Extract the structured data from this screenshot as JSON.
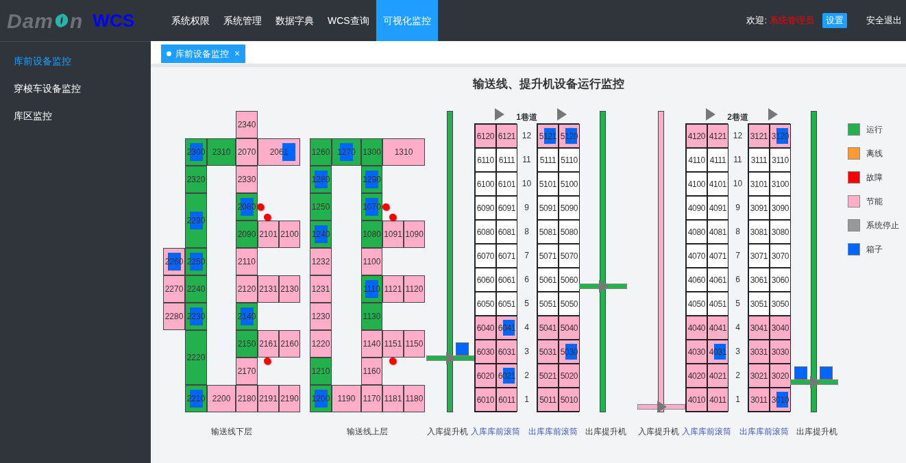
{
  "header": {
    "logo_before": "Dam",
    "logo_after": "n",
    "product": "WCS",
    "nav": [
      {
        "label": "系统权限",
        "selected": false
      },
      {
        "label": "系统管理",
        "selected": false
      },
      {
        "label": "数据字典",
        "selected": false
      },
      {
        "label": "WCS查询",
        "selected": false
      },
      {
        "label": "可视化监控",
        "selected": true
      }
    ],
    "welcome": "欢迎:",
    "user": "系统管理员",
    "settings": "设置",
    "logout": "安全退出"
  },
  "sidebar": {
    "items": [
      {
        "label": "库前设备监控",
        "selected": true
      },
      {
        "label": "穿梭车设备监控",
        "selected": false
      },
      {
        "label": "库区监控",
        "selected": false
      }
    ]
  },
  "tabs": [
    {
      "label": "库前设备监控",
      "selected": true,
      "close": "×"
    }
  ],
  "title": "输送线、提升机设备运行监控",
  "conveyors": [
    {
      "label": "输送线下层",
      "cells": [
        {
          "label": "2340",
          "color": "#ffaec9",
          "box": false
        },
        {
          "label": "2300",
          "color": "#22b14c",
          "box": true
        },
        {
          "label": "2310",
          "color": "#22b14c",
          "box": false
        },
        {
          "label": "2070",
          "color": "#ffaec9",
          "box": false
        },
        {
          "label": "2061",
          "color": "#ffaec9",
          "box": true
        },
        {
          "label": "2320",
          "color": "#22b14c",
          "box": false
        },
        {
          "label": "2330",
          "color": "#ffaec9",
          "box": false
        },
        {
          "label": "2290",
          "color": "#22b14c",
          "box": true
        },
        {
          "label": "2080",
          "color": "#22b14c",
          "box": true
        },
        {
          "label": "2090",
          "color": "#22b14c",
          "box": false
        },
        {
          "label": "2101",
          "color": "#ffaec9",
          "box": false
        },
        {
          "label": "2100",
          "color": "#ffaec9",
          "box": false
        },
        {
          "label": "2260",
          "color": "#ffaec9",
          "box": true
        },
        {
          "label": "2250",
          "color": "#22b14c",
          "box": true
        },
        {
          "label": "2110",
          "color": "#ffaec9",
          "box": false
        },
        {
          "label": "2270",
          "color": "#ffaec9",
          "box": false
        },
        {
          "label": "2240",
          "color": "#22b14c",
          "box": false
        },
        {
          "label": "2120",
          "color": "#ffaec9",
          "box": false
        },
        {
          "label": "2131",
          "color": "#ffaec9",
          "box": false
        },
        {
          "label": "2130",
          "color": "#ffaec9",
          "box": false
        },
        {
          "label": "2280",
          "color": "#ffaec9",
          "box": false
        },
        {
          "label": "2230",
          "color": "#22b14c",
          "box": true
        },
        {
          "label": "2140",
          "color": "#22b14c",
          "box": true
        },
        {
          "label": "2220",
          "color": "#22b14c",
          "box": false
        },
        {
          "label": "2150",
          "color": "#22b14c",
          "box": false
        },
        {
          "label": "2161",
          "color": "#ffaec9",
          "box": false
        },
        {
          "label": "2160",
          "color": "#ffaec9",
          "box": false
        },
        {
          "label": "2170",
          "color": "#ffaec9",
          "box": false
        },
        {
          "label": "2210",
          "color": "#22b14c",
          "box": true
        },
        {
          "label": "2200",
          "color": "#ffaec9",
          "box": false
        },
        {
          "label": "2180",
          "color": "#ffaec9",
          "box": false
        },
        {
          "label": "2191",
          "color": "#ffaec9",
          "box": false
        },
        {
          "label": "2190",
          "color": "#ffaec9",
          "box": false
        }
      ]
    },
    {
      "label": "输送线上层",
      "cells": [
        {
          "label": "1260",
          "color": "#22b14c",
          "box": false
        },
        {
          "label": "1270",
          "color": "#22b14c",
          "box": true
        },
        {
          "label": "1300",
          "color": "#22b14c",
          "box": false
        },
        {
          "label": "1310",
          "color": "#ffaec9",
          "box": false
        },
        {
          "label": "1280",
          "color": "#22b14c",
          "box": true
        },
        {
          "label": "1290",
          "color": "#22b14c",
          "box": true
        },
        {
          "label": "1250",
          "color": "#22b14c",
          "box": false
        },
        {
          "label": "1070",
          "color": "#22b14c",
          "box": true
        },
        {
          "label": "1240",
          "color": "#22b14c",
          "box": true
        },
        {
          "label": "1080",
          "color": "#22b14c",
          "box": false
        },
        {
          "label": "1091",
          "color": "#ffaec9",
          "box": false
        },
        {
          "label": "1090",
          "color": "#ffaec9",
          "box": false
        },
        {
          "label": "1232",
          "color": "#ffaec9",
          "box": false
        },
        {
          "label": "1100",
          "color": "#ffaec9",
          "box": false
        },
        {
          "label": "1231",
          "color": "#ffaec9",
          "box": false
        },
        {
          "label": "1110",
          "color": "#22b14c",
          "box": true
        },
        {
          "label": "1121",
          "color": "#ffaec9",
          "box": false
        },
        {
          "label": "1120",
          "color": "#ffaec9",
          "box": false
        },
        {
          "label": "1230",
          "color": "#ffaec9",
          "box": false
        },
        {
          "label": "1130",
          "color": "#22b14c",
          "box": false
        },
        {
          "label": "1220",
          "color": "#ffaec9",
          "box": false
        },
        {
          "label": "1140",
          "color": "#ffaec9",
          "box": false
        },
        {
          "label": "1151",
          "color": "#ffaec9",
          "box": false
        },
        {
          "label": "1150",
          "color": "#ffaec9",
          "box": false
        },
        {
          "label": "1210",
          "color": "#22b14c",
          "box": false
        },
        {
          "label": "1160",
          "color": "#ffaec9",
          "box": false
        },
        {
          "label": "1200",
          "color": "#22b14c",
          "box": true
        },
        {
          "label": "1190",
          "color": "#ffaec9",
          "box": false
        },
        {
          "label": "1170",
          "color": "#ffaec9",
          "box": false
        },
        {
          "label": "1181",
          "color": "#ffaec9",
          "box": false
        },
        {
          "label": "1180",
          "color": "#ffaec9",
          "box": false
        }
      ]
    }
  ],
  "aisles": [
    {
      "title": "1巷道",
      "levels": [
        "12",
        "11",
        "10",
        "9",
        "8",
        "7",
        "6",
        "5",
        "4",
        "3",
        "2",
        "1"
      ],
      "lifts": [
        {
          "color": "#22b14c",
          "level": 0.17,
          "box_left": false,
          "box_right": true
        },
        {
          "color": "#22b14c",
          "level": 0.41,
          "box_left": false,
          "box_right": false
        }
      ],
      "racks": [
        {
          "cells": [
            {
              "label": "6120",
              "color": "#ffaec9",
              "box": false
            },
            {
              "label": "6121",
              "color": "#ffaec9",
              "box": false
            },
            {
              "label": "6110",
              "color": "#ffffff",
              "box": false
            },
            {
              "label": "6111",
              "color": "#ffffff",
              "box": false
            },
            {
              "label": "6100",
              "color": "#ffffff",
              "box": false
            },
            {
              "label": "6101",
              "color": "#ffffff",
              "box": false
            },
            {
              "label": "6090",
              "color": "#ffffff",
              "box": false
            },
            {
              "label": "6091",
              "color": "#ffffff",
              "box": false
            },
            {
              "label": "6080",
              "color": "#ffffff",
              "box": false
            },
            {
              "label": "6081",
              "color": "#ffffff",
              "box": false
            },
            {
              "label": "6070",
              "color": "#ffffff",
              "box": false
            },
            {
              "label": "6071",
              "color": "#ffffff",
              "box": false
            },
            {
              "label": "6060",
              "color": "#ffffff",
              "box": false
            },
            {
              "label": "6061",
              "color": "#ffffff",
              "box": false
            },
            {
              "label": "6050",
              "color": "#ffffff",
              "box": false
            },
            {
              "label": "6051",
              "color": "#ffffff",
              "box": false
            },
            {
              "label": "6040",
              "color": "#ffaec9",
              "box": false
            },
            {
              "label": "6041",
              "color": "#ffaec9",
              "box": true
            },
            {
              "label": "6030",
              "color": "#ffaec9",
              "box": false
            },
            {
              "label": "6031",
              "color": "#ffaec9",
              "box": false
            },
            {
              "label": "6020",
              "color": "#ffaec9",
              "box": false
            },
            {
              "label": "6021",
              "color": "#ffaec9",
              "box": true
            },
            {
              "label": "6010",
              "color": "#ffaec9",
              "box": false
            },
            {
              "label": "6011",
              "color": "#ffaec9",
              "box": false
            }
          ]
        },
        {
          "cells": [
            {
              "label": "5121",
              "color": "#ffaec9",
              "box": true
            },
            {
              "label": "5120",
              "color": "#ffaec9",
              "box": true
            },
            {
              "label": "5111",
              "color": "#ffffff",
              "box": false
            },
            {
              "label": "5110",
              "color": "#ffffff",
              "box": false
            },
            {
              "label": "5101",
              "color": "#ffffff",
              "box": false
            },
            {
              "label": "5100",
              "color": "#ffffff",
              "box": false
            },
            {
              "label": "5091",
              "color": "#ffffff",
              "box": false
            },
            {
              "label": "5090",
              "color": "#ffffff",
              "box": false
            },
            {
              "label": "5081",
              "color": "#ffffff",
              "box": false
            },
            {
              "label": "5080",
              "color": "#ffffff",
              "box": false
            },
            {
              "label": "5071",
              "color": "#ffffff",
              "box": false
            },
            {
              "label": "5070",
              "color": "#ffffff",
              "box": false
            },
            {
              "label": "5061",
              "color": "#ffffff",
              "box": false
            },
            {
              "label": "5060",
              "color": "#ffffff",
              "box": false
            },
            {
              "label": "5051",
              "color": "#ffffff",
              "box": false
            },
            {
              "label": "5050",
              "color": "#ffffff",
              "box": false
            },
            {
              "label": "5041",
              "color": "#ffaec9",
              "box": false
            },
            {
              "label": "5040",
              "color": "#ffaec9",
              "box": false
            },
            {
              "label": "5031",
              "color": "#ffaec9",
              "box": false
            },
            {
              "label": "5030",
              "color": "#ffaec9",
              "box": true
            },
            {
              "label": "5021",
              "color": "#ffaec9",
              "box": false
            },
            {
              "label": "5020",
              "color": "#ffaec9",
              "box": false
            },
            {
              "label": "5011",
              "color": "#ffaec9",
              "box": false
            },
            {
              "label": "5010",
              "color": "#ffaec9",
              "box": false
            }
          ]
        }
      ],
      "labels": [
        "入库提升机",
        "入库库前滚筒",
        "出库库前滚筒",
        "出库提升机"
      ]
    },
    {
      "title": "2巷道",
      "levels": [
        "12",
        "11",
        "10",
        "9",
        "8",
        "7",
        "6",
        "5",
        "4",
        "3",
        "2",
        "1"
      ],
      "lifts": [
        {
          "color": "#ffaec9",
          "level": 0.01,
          "box_left": false,
          "box_right": false
        },
        {
          "color": "#22b14c",
          "level": 0.09,
          "box_left": true,
          "box_right": true
        }
      ],
      "racks": [
        {
          "cells": [
            {
              "label": "4120",
              "color": "#ffaec9",
              "box": false
            },
            {
              "label": "4121",
              "color": "#ffaec9",
              "box": false
            },
            {
              "label": "4110",
              "color": "#ffffff",
              "box": false
            },
            {
              "label": "4111",
              "color": "#ffffff",
              "box": false
            },
            {
              "label": "4100",
              "color": "#ffffff",
              "box": false
            },
            {
              "label": "4101",
              "color": "#ffffff",
              "box": false
            },
            {
              "label": "4090",
              "color": "#ffffff",
              "box": false
            },
            {
              "label": "4091",
              "color": "#ffffff",
              "box": false
            },
            {
              "label": "4080",
              "color": "#ffffff",
              "box": false
            },
            {
              "label": "4081",
              "color": "#ffffff",
              "box": false
            },
            {
              "label": "4070",
              "color": "#ffffff",
              "box": false
            },
            {
              "label": "4071",
              "color": "#ffffff",
              "box": false
            },
            {
              "label": "4060",
              "color": "#ffffff",
              "box": false
            },
            {
              "label": "4061",
              "color": "#ffffff",
              "box": false
            },
            {
              "label": "4050",
              "color": "#ffffff",
              "box": false
            },
            {
              "label": "4051",
              "color": "#ffffff",
              "box": false
            },
            {
              "label": "4040",
              "color": "#ffaec9",
              "box": false
            },
            {
              "label": "4041",
              "color": "#ffaec9",
              "box": false
            },
            {
              "label": "4030",
              "color": "#ffaec9",
              "box": false
            },
            {
              "label": "4031",
              "color": "#ffaec9",
              "box": true
            },
            {
              "label": "4020",
              "color": "#ffaec9",
              "box": false
            },
            {
              "label": "4021",
              "color": "#ffaec9",
              "box": false
            },
            {
              "label": "4010",
              "color": "#ffaec9",
              "box": false
            },
            {
              "label": "4011",
              "color": "#ffaec9",
              "box": false
            }
          ]
        },
        {
          "cells": [
            {
              "label": "3121",
              "color": "#ffaec9",
              "box": false
            },
            {
              "label": "3120",
              "color": "#ffaec9",
              "box": true
            },
            {
              "label": "3111",
              "color": "#ffffff",
              "box": false
            },
            {
              "label": "3110",
              "color": "#ffffff",
              "box": false
            },
            {
              "label": "3101",
              "color": "#ffffff",
              "box": false
            },
            {
              "label": "3100",
              "color": "#ffffff",
              "box": false
            },
            {
              "label": "3091",
              "color": "#ffffff",
              "box": false
            },
            {
              "label": "3090",
              "color": "#ffffff",
              "box": false
            },
            {
              "label": "3081",
              "color": "#ffffff",
              "box": false
            },
            {
              "label": "3080",
              "color": "#ffffff",
              "box": false
            },
            {
              "label": "3071",
              "color": "#ffffff",
              "box": false
            },
            {
              "label": "3070",
              "color": "#ffffff",
              "box": false
            },
            {
              "label": "3061",
              "color": "#ffffff",
              "box": false
            },
            {
              "label": "3060",
              "color": "#ffffff",
              "box": false
            },
            {
              "label": "3051",
              "color": "#ffffff",
              "box": false
            },
            {
              "label": "3050",
              "color": "#ffffff",
              "box": false
            },
            {
              "label": "3041",
              "color": "#ffaec9",
              "box": false
            },
            {
              "label": "3040",
              "color": "#ffaec9",
              "box": false
            },
            {
              "label": "3031",
              "color": "#ffaec9",
              "box": false
            },
            {
              "label": "3030",
              "color": "#ffaec9",
              "box": false
            },
            {
              "label": "3021",
              "color": "#ffaec9",
              "box": false
            },
            {
              "label": "3020",
              "color": "#ffaec9",
              "box": false
            },
            {
              "label": "3011",
              "color": "#ffaec9",
              "box": false
            },
            {
              "label": "3010",
              "color": "#ffaec9",
              "box": true
            }
          ]
        }
      ],
      "labels": [
        "入库提升机",
        "入库库前滚筒",
        "出库库前滚筒",
        "出库提升机"
      ]
    }
  ],
  "legend": [
    {
      "label": "运行",
      "color": "#22b14c"
    },
    {
      "label": "离线",
      "color": "#ff9933"
    },
    {
      "label": "故障",
      "color": "#ff0000"
    },
    {
      "label": "节能",
      "color": "#ffaec9"
    },
    {
      "label": "系统停止",
      "color": "#999999"
    },
    {
      "label": "箱子",
      "color": "#0066ff"
    }
  ]
}
